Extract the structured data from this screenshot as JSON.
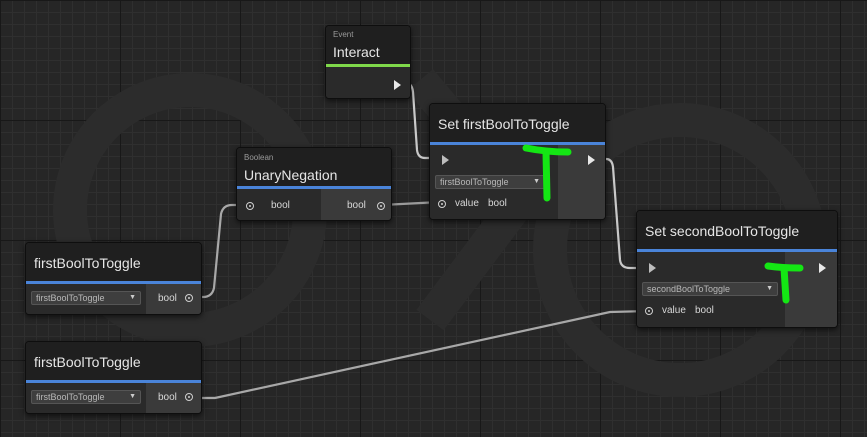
{
  "nodes": {
    "event_interact": {
      "subtitle": "Event",
      "title": "Interact"
    },
    "unary_negation": {
      "subtitle": "Boolean",
      "title": "UnaryNegation",
      "in_label": "bool",
      "out_label": "bool"
    },
    "var_first_a": {
      "title": "firstBoolToToggle",
      "dropdown": "firstBoolToToggle",
      "out_label": "bool"
    },
    "var_first_b": {
      "title": "firstBoolToToggle",
      "dropdown": "firstBoolToToggle",
      "out_label": "bool"
    },
    "set_first": {
      "title": "Set firstBoolToToggle",
      "dropdown": "firstBoolToToggle",
      "value_label": "value",
      "value_type": "bool"
    },
    "set_second": {
      "title": "Set secondBoolToToggle",
      "dropdown": "secondBoolToToggle",
      "value_label": "value",
      "value_type": "bool"
    }
  },
  "icons": {
    "dropdown_caret": "triangle-down",
    "flow_port": "triangle-right",
    "data_port": "circle-dot",
    "annotation": "green-T-mark"
  },
  "colors": {
    "accent_blue": "#4a84d9",
    "accent_green": "#7fd84a",
    "annotation_green": "#14e614",
    "wire": "#c8c8c8"
  }
}
